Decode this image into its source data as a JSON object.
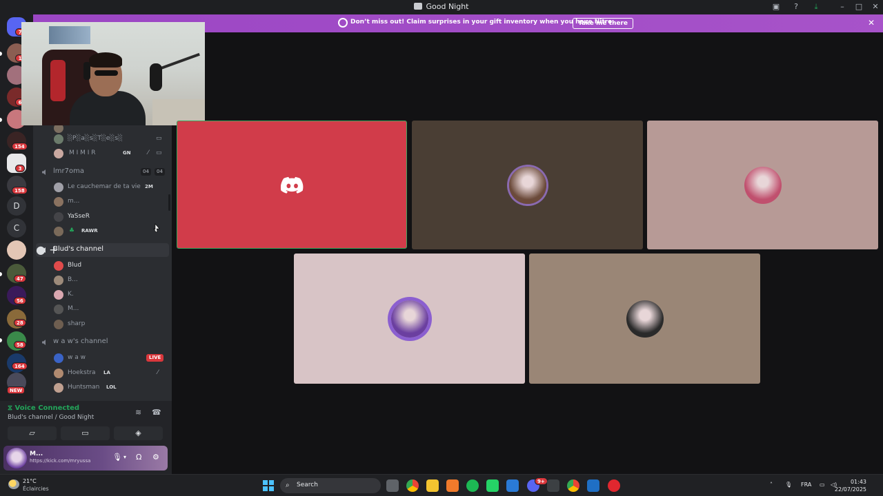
{
  "window": {
    "title": "Good Night"
  },
  "banner": {
    "message": "Don’t miss out! Claim surprises in your gift inventory when you have Nitro.",
    "cta_label": "Take me there"
  },
  "rail": {
    "letters": [
      "D",
      "C"
    ],
    "badges": [
      "7",
      "1",
      "6",
      "154",
      "3",
      "158",
      "47",
      "56",
      "28",
      "58",
      "164"
    ],
    "new_label": "NEW"
  },
  "channels": {
    "top_members": [
      {
        "name": "░P░a░s░T░e░s░",
        "tag": "",
        "color": "#6b7b6b"
      },
      {
        "name": "M I M I R",
        "tag": "GN",
        "color": "#c9a8a0"
      }
    ],
    "lmr7oma": {
      "name": "lmr7oma",
      "count_a": "04",
      "count_b": "04",
      "members": [
        {
          "name": "Le cauchemar de ta vie",
          "tag": "2M",
          "color": "#a0a0a8"
        },
        {
          "name": "m...",
          "tag": "",
          "color": "#8a7260"
        },
        {
          "name": "YaSseR",
          "tag": "",
          "color": "#444448"
        },
        {
          "name": "",
          "tag": "RAWR",
          "color": "#7a6a5a"
        }
      ]
    },
    "bluds": {
      "name": "Blud's channel",
      "members": [
        {
          "name": "Blud",
          "tag": "",
          "color": "#e04b4b"
        },
        {
          "name": "B...",
          "tag": "",
          "color": "#9c8a7a"
        },
        {
          "name": "K.",
          "tag": "",
          "color": "#d9a7b0"
        },
        {
          "name": "M...",
          "tag": "",
          "color": "#555"
        },
        {
          "name": "sharp",
          "tag": "",
          "color": "#6e5e50"
        }
      ]
    },
    "waw": {
      "name": "w a w's channel",
      "live_label": "LIVE",
      "members": [
        {
          "name": "w a w",
          "tag": "",
          "color": "#3a63c6"
        },
        {
          "name": "Hoekstra",
          "tag": "LA",
          "color": "#b08a70"
        },
        {
          "name": "Huntsman",
          "tag": "LOL",
          "color": "#c0a090"
        }
      ]
    }
  },
  "voice": {
    "status": "Voice Connected",
    "location": "Blud's channel / Good Night"
  },
  "user": {
    "name": "M...",
    "status": "https://kick.com/mryussa"
  },
  "stage": {
    "tiles": [
      {
        "bg": "#d13c4a",
        "kind": "discord"
      },
      {
        "bg": "#4a3e34",
        "avatar": "#6b4a3a"
      },
      {
        "bg": "#b79a96",
        "avatar": "#c0506e"
      },
      {
        "bg": "#d8c4c6",
        "avatar": "#6b3fa0"
      },
      {
        "bg": "#9a8676",
        "avatar": "#2a2a2a"
      }
    ]
  },
  "taskbar": {
    "temp": "21°C",
    "weather": "Éclaircies",
    "search_label": "Search",
    "lang": "FRA",
    "time": "01:43",
    "date": "22/07/2025",
    "discord_badge": "9+"
  },
  "colors": {
    "accent": "#5865f2",
    "banner": "#a24ec7",
    "live": "#da373c",
    "voice_green": "#23a55a"
  }
}
